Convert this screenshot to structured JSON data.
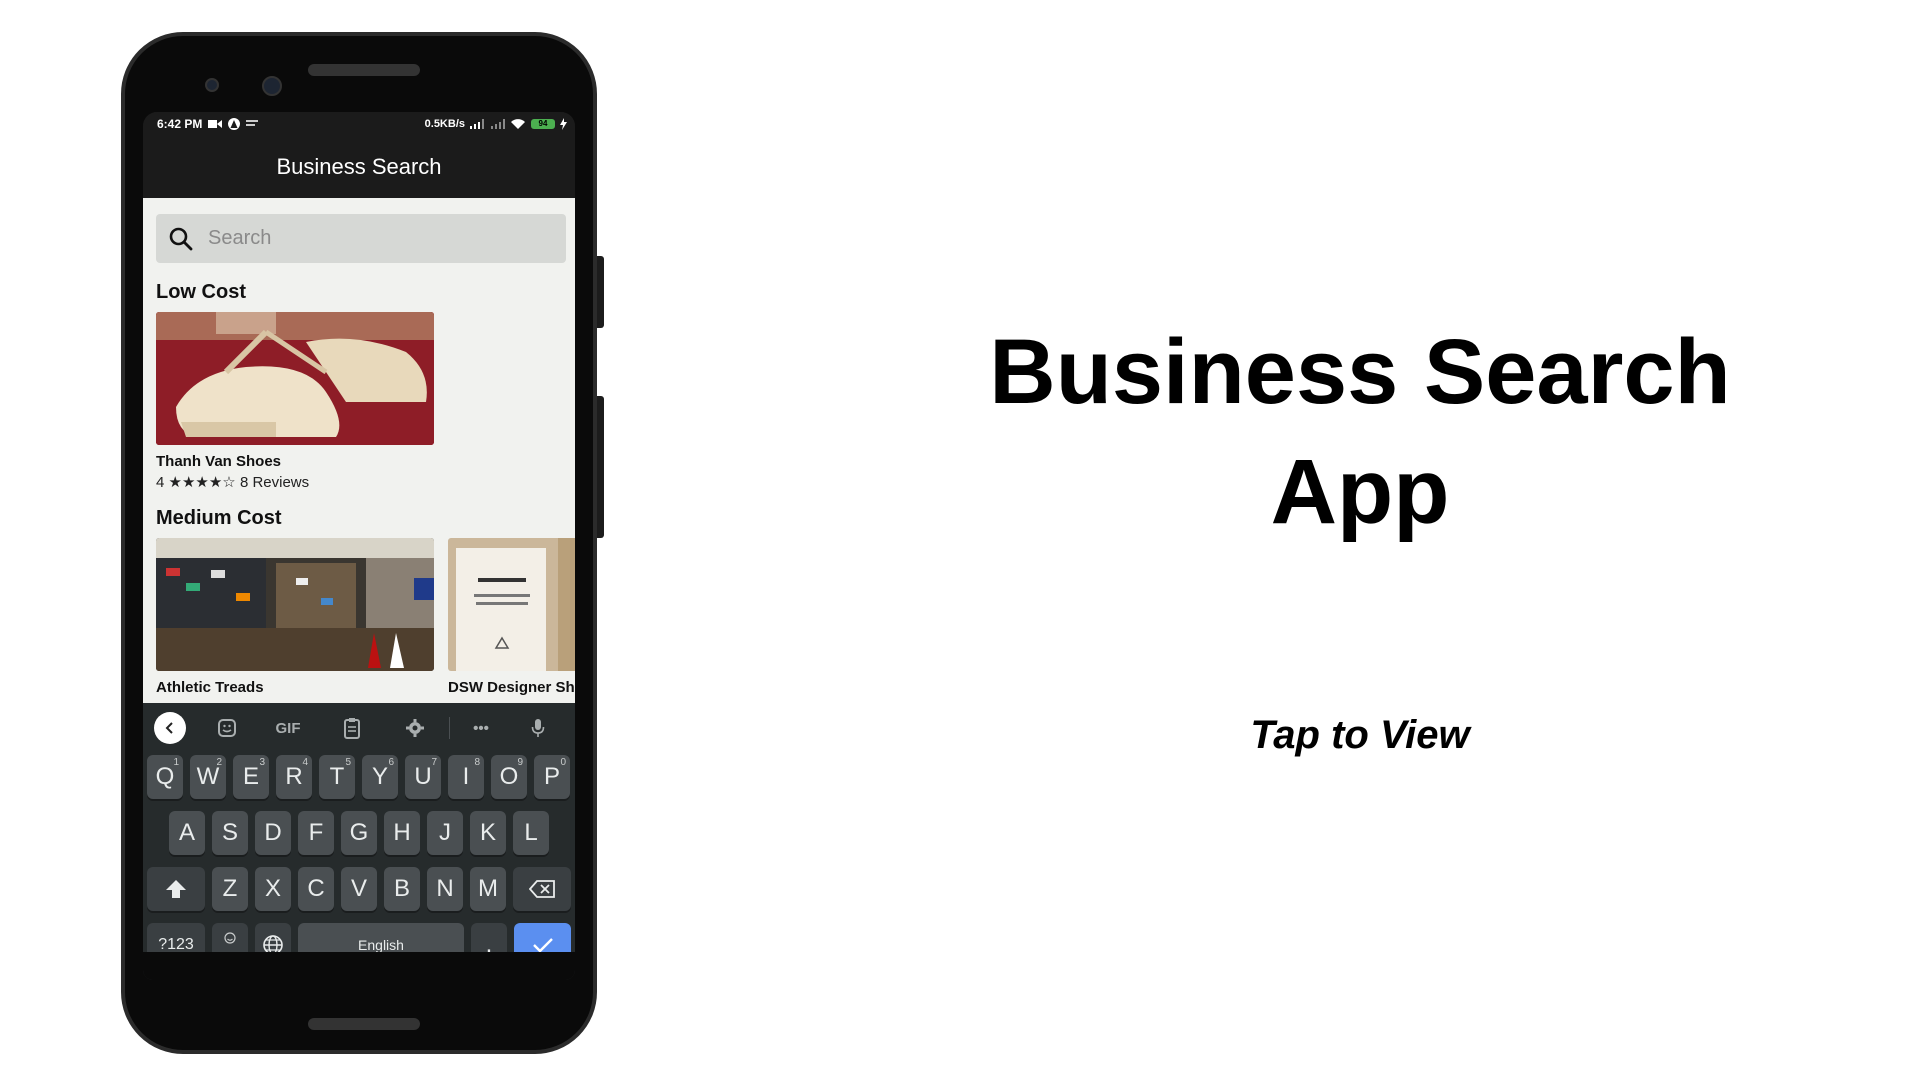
{
  "status_bar": {
    "time": "6:42 PM",
    "speed": "0.5KB/s",
    "battery": "94"
  },
  "app": {
    "title": "Business Search"
  },
  "search": {
    "placeholder": "Search"
  },
  "sections": [
    {
      "title": "Low Cost",
      "items": [
        {
          "name": "Thanh Van Shoes",
          "rating_value": "4",
          "stars": "★★★★☆",
          "reviews": "8 Reviews"
        }
      ]
    },
    {
      "title": "Medium Cost",
      "items": [
        {
          "name": "Athletic Treads"
        },
        {
          "name": "DSW Designer Shoe"
        }
      ]
    }
  ],
  "keyboard": {
    "toolbar": {
      "gif": "GIF",
      "more": "•••"
    },
    "row1": [
      {
        "key": "Q",
        "hint": "1"
      },
      {
        "key": "W",
        "hint": "2"
      },
      {
        "key": "E",
        "hint": "3"
      },
      {
        "key": "R",
        "hint": "4"
      },
      {
        "key": "T",
        "hint": "5"
      },
      {
        "key": "Y",
        "hint": "6"
      },
      {
        "key": "U",
        "hint": "7"
      },
      {
        "key": "I",
        "hint": "8"
      },
      {
        "key": "O",
        "hint": "9"
      },
      {
        "key": "P",
        "hint": "0"
      }
    ],
    "row2": [
      "A",
      "S",
      "D",
      "F",
      "G",
      "H",
      "J",
      "K",
      "L"
    ],
    "row3": [
      "Z",
      "X",
      "C",
      "V",
      "B",
      "N",
      "M"
    ],
    "symbols_label": "?123",
    "comma_label": ",",
    "space_label": "English",
    "period_label": "."
  },
  "promo": {
    "title_line1": "Business Search",
    "title_line2": "App",
    "cta": "Tap to View"
  }
}
